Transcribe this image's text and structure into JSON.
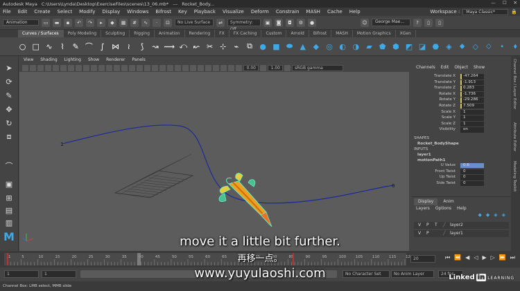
{
  "titlebar": {
    "app": "Autodesk Maya",
    "path": "C:\\Users\\Lynda\\Desktop\\ExerciseFiles\\scenes\\13_06.mb*",
    "sep": "---",
    "object": "Rocket_Body..."
  },
  "menubar": {
    "items": [
      "File",
      "Edit",
      "Create",
      "Select",
      "Modify",
      "Display",
      "Windows",
      "Bifrost",
      "Key",
      "Playback",
      "Visualize",
      "Deform",
      "Constrain",
      "MASH",
      "Cache",
      "Help"
    ],
    "workspace_label": "Workspace :",
    "workspace_value": "Maya Classic*"
  },
  "statusline": {
    "menuset": "Animation",
    "live_surface": "No Live Surface",
    "symmetry": "Symmetry: Off",
    "user": "George Mae..."
  },
  "shelf_tabs": [
    "Curves / Surfaces",
    "Poly Modeling",
    "Sculpting",
    "Rigging",
    "Animation",
    "Rendering",
    "FX",
    "FX Caching",
    "Custom",
    "Arnold",
    "Bifrost",
    "MASH",
    "Motion Graphics",
    "XGen"
  ],
  "shelf_active": "Curves / Surfaces",
  "viewport": {
    "menu": [
      "View",
      "Shading",
      "Lighting",
      "Show",
      "Renderer",
      "Panels"
    ],
    "field1": "0.00",
    "field2": "1.00",
    "colorspace": "sRGB gamma"
  },
  "channelbox": {
    "tabs": [
      "Channels",
      "Edit",
      "Object",
      "Show"
    ],
    "attrs": [
      {
        "name": "Translate X",
        "value": "-47.264"
      },
      {
        "name": "Translate Y",
        "value": "-1.913"
      },
      {
        "name": "Translate Z",
        "value": "0.283"
      },
      {
        "name": "Rotate X",
        "value": "-1.736"
      },
      {
        "name": "Rotate Y",
        "value": "-29.286"
      },
      {
        "name": "Rotate Z",
        "value": "7.509"
      },
      {
        "name": "Scale X",
        "value": "1"
      },
      {
        "name": "Scale Y",
        "value": "1"
      },
      {
        "name": "Scale Z",
        "value": "1"
      },
      {
        "name": "Visibility",
        "value": "on"
      }
    ],
    "shapes_label": "SHAPES",
    "shape": "Rocket_BodyShape",
    "inputs_label": "INPUTS",
    "input1": "layer1",
    "input2": "motionPath1",
    "motion": [
      {
        "name": "U Value",
        "value": "0.6"
      },
      {
        "name": "Front Twist",
        "value": "0"
      },
      {
        "name": "Up Twist",
        "value": "0"
      },
      {
        "name": "Side Twist",
        "value": "0"
      }
    ]
  },
  "side_tabs": [
    "Channel Box / Layer Editor",
    "Attribute Editor",
    "Modeling Toolkit"
  ],
  "layers": {
    "tabs": [
      "Display",
      "Anim"
    ],
    "menu": [
      "Layers",
      "Options",
      "Help"
    ],
    "rows": [
      {
        "v": "V",
        "p": "P",
        "t": "T",
        "name": "layer2"
      },
      {
        "v": "V",
        "p": "P",
        "t": "",
        "name": "layer1"
      }
    ]
  },
  "timeline": {
    "ticks": [
      "1",
      "5",
      "10",
      "15",
      "20",
      "25",
      "30",
      "35",
      "40",
      "45",
      "50",
      "55",
      "60",
      "65",
      "70",
      "75",
      "80",
      "85",
      "90",
      "95",
      "100",
      "105",
      "110",
      "115",
      "120"
    ],
    "current": "20",
    "current_field": "20"
  },
  "range": {
    "start": "1",
    "start2": "1",
    "character_set": "No Character Set",
    "anim_layer": "No Anim Layer",
    "fps": "24 fps"
  },
  "helpline": "Channel Box: LMB select, MMB slide",
  "subtitles": {
    "en": "move it a little bit further.",
    "cn": "再移一点。",
    "url": "www.yuyulaoshi.com"
  },
  "watermark": {
    "linked": "Linked",
    "in": "in",
    "learning": "LEARNING"
  },
  "colors": {
    "accent": "#3fa9e8",
    "rocket_body": "#f0a020",
    "selection": "#5cf0c8",
    "curve": "#1a2a9a",
    "timeline_marker": "#c03030"
  }
}
